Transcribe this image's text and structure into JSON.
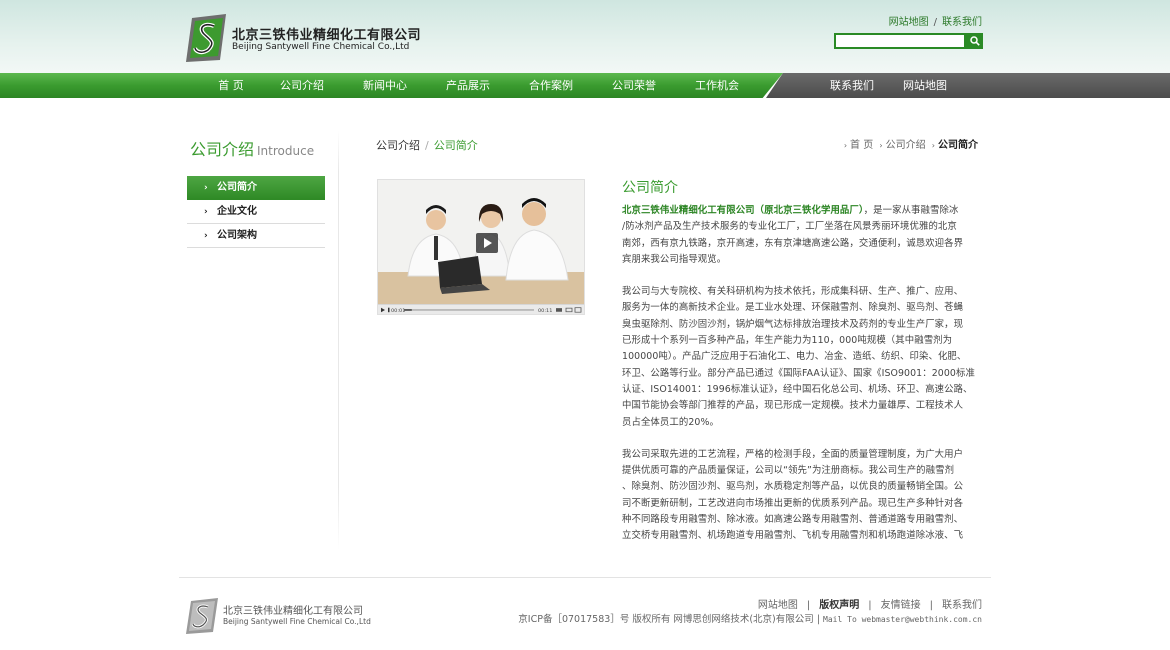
{
  "header": {
    "company_cn": "北京三铁伟业精细化工有限公司",
    "company_en": "Beijing Santywell Fine Chemical Co.,Ltd",
    "links": [
      "网站地图",
      "联系我们"
    ],
    "link_sep": "/",
    "search": {
      "value": "",
      "placeholder": ""
    }
  },
  "nav": {
    "main": [
      "首 页",
      "公司介绍",
      "新闻中心",
      "产品展示",
      "合作案例",
      "公司荣誉",
      "工作机会"
    ],
    "right": [
      "联系我们",
      "网站地图"
    ]
  },
  "sidebar": {
    "title_cn": "公司介绍",
    "title_en": "Introduce",
    "items": [
      {
        "label": "公司简介",
        "active": true
      },
      {
        "label": "企业文化",
        "active": false
      },
      {
        "label": "公司架构",
        "active": false
      }
    ]
  },
  "breadcrumb": {
    "left_parent": "公司介绍",
    "left_sep": "/",
    "left_current": "公司简介",
    "right": [
      "首 页",
      "公司介绍",
      "公司简介"
    ]
  },
  "video": {
    "current_time": "00:01",
    "total_time": "00:11",
    "progress": 0.06
  },
  "article": {
    "title": "公司简介",
    "p1_highlight": "北京三铁伟业精细化工有限公司（原北京三铁化学用品厂）",
    "p1_lines": [
      "，是一家从事融雪除冰",
      "/防冰剂产品及生产技术服务的专业化工厂，工厂坐落在风景秀丽环境优雅的北京",
      "南郊，西有京九铁路，京开高速，东有京津塘高速公路，交通便利，诚恳欢迎各界",
      "宾朋来我公司指导观览。"
    ],
    "p2_lines": [
      "我公司与大专院校、有关科研机构为技术依托，形成集科研、生产、推广、应用、",
      "服务为一体的高新技术企业。是工业水处理、环保融雪剂、除臭剂、驱鸟剂、苍蝇",
      "臭虫驱除剂、防沙固沙剂，锅炉烟气达标排放治理技术及药剂的专业生产厂家，现",
      "已形成十个系列一百多种产品，年生产能力为110，000吨规模（其中融雪剂为",
      "100000吨）。产品广泛应用于石油化工、电力、冶金、造纸、纺织、印染、化肥、",
      "环卫、公路等行业。部分产品已通过《国际FAA认证》、国家《ISO9001：2000标准",
      "认证、ISO14001：1996标准认证》，经中国石化总公司、机场、环卫、高速公路、",
      "中国节能协会等部门推荐的产品，现已形成一定规模。技术力量雄厚、工程技术人",
      "员占全体员工的20%。"
    ],
    "p3_lines": [
      "我公司采取先进的工艺流程，严格的检测手段，全面的质量管理制度，为广大用户",
      "提供优质可靠的产品质量保证，公司以“领先”为注册商标。我公司生产的融雪剂",
      "、除臭剂、防沙固沙剂、驱鸟剂，水质稳定剂等产品，以优良的质量畅销全国。公",
      "司不断更新研制，工艺改进向市场推出更新的优质系列产品。现已生产多种针对各",
      "种不同路段专用融雪剂、除冰液。如高速公路专用融雪剂、普通道路专用融雪剂、",
      "立交桥专用融雪剂、机场跑道专用融雪剂、飞机专用融雪剂和机场跑道除冰液、飞"
    ]
  },
  "footer": {
    "company_cn": "北京三铁伟业精细化工有限公司",
    "company_en": "Beijing Santywell Fine Chemical Co.,Ltd",
    "links": [
      "网站地图",
      "版权声明",
      "友情链接",
      "联系我们"
    ],
    "link_sep": "|",
    "copyright": "京ICP备［07017583］号 版权所有 网博思创网络技术(北京)有限公司",
    "mail_sep": "|",
    "mail": "Mail To webmaster@webthink.com.cn"
  },
  "colors": {
    "brand_green": "#3a9b2f",
    "nav_dark": "#4c4c4c"
  },
  "icons": {
    "search": "search-icon",
    "play": "play-icon",
    "logo": "logo-mark"
  }
}
